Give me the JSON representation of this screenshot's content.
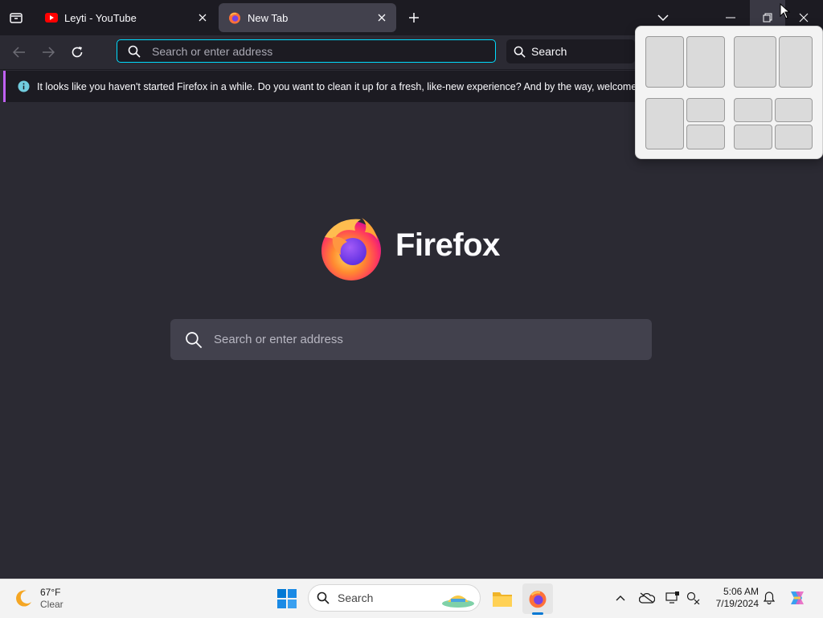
{
  "tabs": [
    {
      "title": "Leyti - YouTube"
    },
    {
      "title": "New Tab"
    }
  ],
  "urlbar": {
    "placeholder": "Search or enter address"
  },
  "searchbar": {
    "label": "Search"
  },
  "notification": {
    "text": "It looks like you haven't started Firefox in a while. Do you want to clean it up for a fresh, like-new experience? And by the way, welcome back!"
  },
  "content": {
    "brand": "Firefox",
    "search_placeholder": "Search or enter address"
  },
  "snap_layouts": {
    "count": 4
  },
  "taskbar": {
    "weather_temp": "67°F",
    "weather_cond": "Clear",
    "search_label": "Search",
    "time": "5:06 AM",
    "date": "7/19/2024"
  },
  "colors": {
    "accent": "#00ddff",
    "tab_bg": "#1c1b22",
    "page_bg": "#2b2a33",
    "notice_accent": "#c061f5"
  },
  "icons": [
    "tab-list-icon",
    "youtube-icon",
    "close-icon",
    "firefox-icon",
    "plus-icon",
    "chevron-down-icon",
    "minimize-icon",
    "restore-icon",
    "back-icon",
    "forward-icon",
    "reload-icon",
    "search-icon",
    "info-icon",
    "moon-icon",
    "windows-start-icon",
    "file-explorer-icon",
    "onedrive-icon",
    "notification-bell-icon"
  ]
}
